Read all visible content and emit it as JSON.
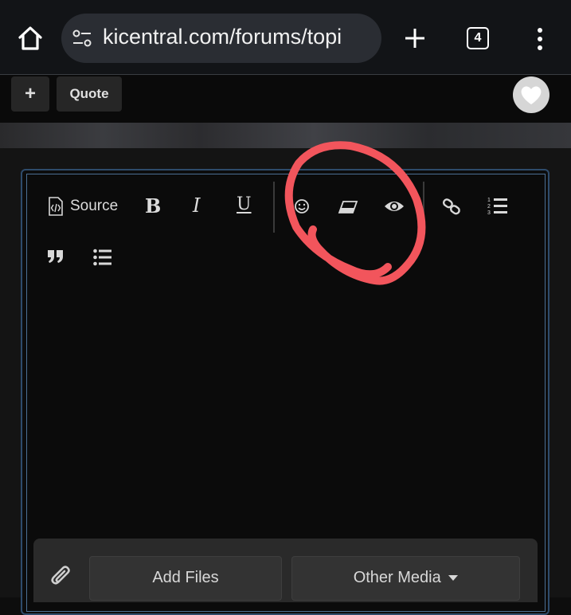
{
  "browser": {
    "url": "kicentral.com/forums/topi",
    "tab_count": "4"
  },
  "page_toolbar": {
    "plus_label": "+",
    "quote_label": "Quote"
  },
  "editor": {
    "toolbar": {
      "source_label": "Source",
      "bold_label": "B",
      "italic_label": "I",
      "underline_label": "U"
    }
  },
  "attachments": {
    "add_files_label": "Add Files",
    "other_media_label": "Other Media"
  },
  "annotation_color": "#f2555c"
}
